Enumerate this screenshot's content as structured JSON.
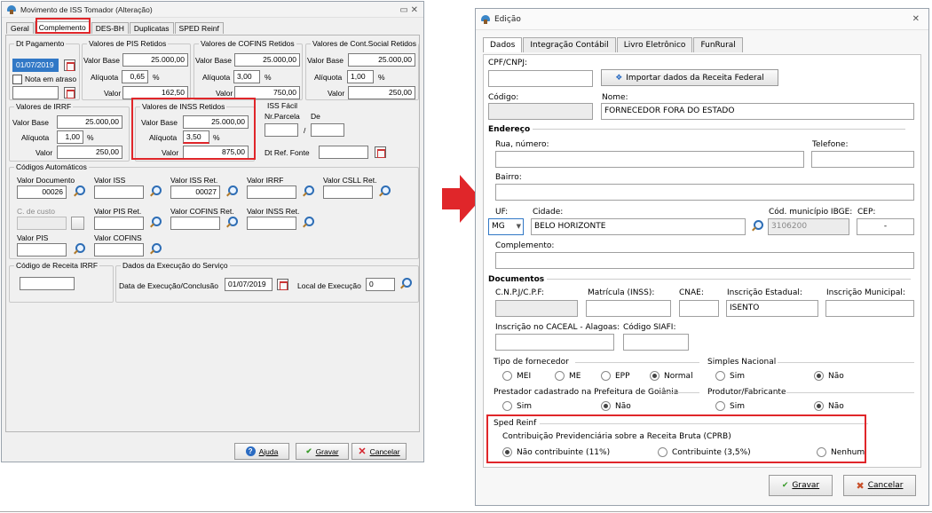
{
  "left": {
    "title": "Movimento de ISS Tomador (Alteração)",
    "controls": "▭  ✕",
    "tabs": [
      "Geral",
      "Complemento",
      "DES-BH",
      "Duplicatas",
      "SPED Reinf"
    ],
    "dt_pagamento": {
      "group": "Dt Pagamento",
      "date": "01/07/2019",
      "nota": "Nota em atraso"
    },
    "pis": {
      "group": "Valores de PIS Retidos",
      "base_lbl": "Valor Base",
      "base": "25.000,00",
      "aliq_lbl": "Alíquota",
      "aliq": "0,65",
      "pct": "%",
      "val_lbl": "Valor",
      "val": "162,50"
    },
    "cofins": {
      "group": "Valores de COFINS Retidos",
      "base_lbl": "Valor Base",
      "base": "25.000,00",
      "aliq_lbl": "Alíquota",
      "aliq": "3,00",
      "pct": "%",
      "val_lbl": "Valor",
      "val": "750,00"
    },
    "csll": {
      "group": "Valores de Cont.Social Retidos",
      "base_lbl": "Valor Base",
      "base": "25.000,00",
      "aliq_lbl": "Alíquota",
      "aliq": "1,00",
      "pct": "%",
      "val_lbl": "Valor",
      "val": "250,00"
    },
    "irrf": {
      "group": "Valores de IRRF",
      "base_lbl": "Valor Base",
      "base": "25.000,00",
      "aliq_lbl": "Alíquota",
      "aliq": "1,00",
      "pct": "%",
      "val_lbl": "Valor",
      "val": "250,00"
    },
    "inss": {
      "group": "Valores de INSS Retidos",
      "base_lbl": "Valor Base",
      "base": "25.000,00",
      "aliq_lbl": "Alíquota",
      "aliq": "3,50",
      "pct": "%",
      "val_lbl": "Valor",
      "val": "875,00"
    },
    "iss_facil": {
      "group": "ISS Fácil",
      "parcela": "Nr.Parcela",
      "de": "De",
      "slash": "/",
      "dt_ref": "Dt Ref. Fonte"
    },
    "codigos": {
      "group": "Códigos Automáticos",
      "valor_documento": "Valor Documento",
      "doc_val": "00026",
      "valor_iss": "Valor ISS",
      "valor_iss_ret": "Valor ISS Ret.",
      "iss_ret_val": "00027",
      "valor_irrf": "Valor IRRF",
      "valor_csll_ret": "Valor CSLL Ret.",
      "c_custo": "C. de custo",
      "valor_pis_ret": "Valor PIS Ret.",
      "valor_cofins_ret": "Valor COFINS Ret.",
      "valor_inss_ret": "Valor INSS Ret.",
      "valor_pis": "Valor PIS",
      "valor_cofins": "Valor COFINS"
    },
    "receita": {
      "group": "Código de Receita IRRF"
    },
    "execucao": {
      "group": "Dados da Execução do Serviço",
      "data_lbl": "Data de Execução/Conclusão",
      "data": "01/07/2019",
      "local_lbl": "Local de Execução",
      "local": "0"
    },
    "buttons": {
      "ajuda": "Ajuda",
      "gravar": "Gravar",
      "cancelar": "Cancelar"
    }
  },
  "right": {
    "title": "Edição",
    "close": "✕",
    "tabs": [
      "Dados",
      "Integração Contábil",
      "Livro Eletrônico",
      "FunRural"
    ],
    "cpf_lbl": "CPF/CNPJ:",
    "importar": "Importar dados da Receita Federal",
    "codigo_lbl": "Código:",
    "nome_lbl": "Nome:",
    "nome": "FORNECEDOR FORA DO ESTADO",
    "endereco": "Endereço",
    "rua_lbl": "Rua, número:",
    "telefone_lbl": "Telefone:",
    "bairro_lbl": "Bairro:",
    "uf_lbl": "UF:",
    "uf": "MG",
    "cidade_lbl": "Cidade:",
    "cidade": "BELO HORIZONTE",
    "ibge_lbl": "Cód. município IBGE:",
    "ibge": "3106200",
    "cep_lbl": "CEP:",
    "cep": "-",
    "complemento_lbl": "Complemento:",
    "documentos": "Documentos",
    "cnpj_lbl": "C.N.P.J/C.P.F:",
    "matricula_lbl": "Matrícula (INSS):",
    "cnae_lbl": "CNAE:",
    "ie_lbl": "Inscrição Estadual:",
    "ie": "ISENTO",
    "im_lbl": "Inscrição Municipal:",
    "caceal_lbl": "Inscrição no CACEAL - Alagoas:",
    "siafi_lbl": "Código SIAFI:",
    "tipo_lbl": "Tipo de fornecedor",
    "tipo_opts": [
      "MEI",
      "ME",
      "EPP",
      "Normal"
    ],
    "simples_lbl": "Simples Nacional",
    "sim": "Sim",
    "nao": "Não",
    "prestador_lbl": "Prestador cadastrado na Prefeitura de Goiânia",
    "produtor_lbl": "Produtor/Fabricante",
    "sped_lbl": "Sped Reinf",
    "cprb_lbl": "Contribuição Previdenciária sobre a Receita Bruta (CPRB)",
    "cprb_opts": [
      "Não contribuinte (11%)",
      "Contribuinte (3,5%)",
      "Nenhum"
    ],
    "gravar": "Gravar",
    "cancelar": "Cancelar"
  },
  "colors": {
    "highlight": "#e0262a",
    "arrow": "#e0262a",
    "selection": "#3178c6"
  }
}
